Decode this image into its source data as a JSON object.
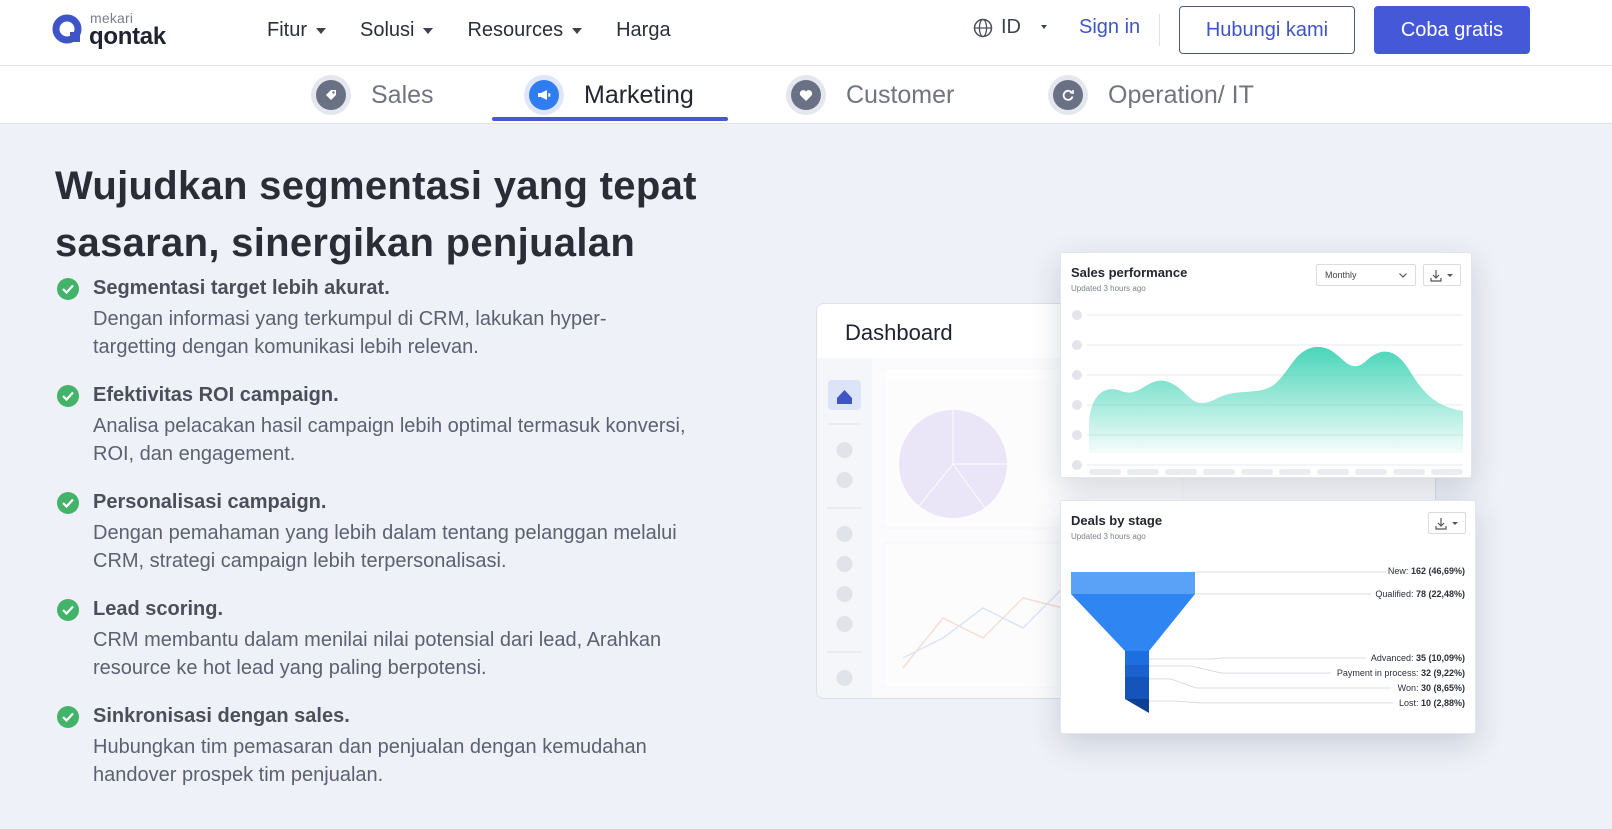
{
  "brand": {
    "small": "mekari",
    "big": "qontak",
    "color": "#3f55c7"
  },
  "nav": {
    "menu": [
      {
        "label": "Fitur",
        "dropdown": true
      },
      {
        "label": "Solusi",
        "dropdown": true
      },
      {
        "label": "Resources",
        "dropdown": true
      },
      {
        "label": "Harga",
        "dropdown": false
      }
    ],
    "language": "ID",
    "signin": "Sign in",
    "contact_button": "Hubungi kami",
    "trial_button": "Coba gratis"
  },
  "tabs": [
    {
      "label": "Sales",
      "icon": "tag-icon",
      "active": false
    },
    {
      "label": "Marketing",
      "icon": "megaphone-icon",
      "active": true
    },
    {
      "label": "Customer",
      "icon": "heart-icon",
      "active": false
    },
    {
      "label": "Operation/ IT",
      "icon": "refresh-icon",
      "active": false
    }
  ],
  "hero": {
    "headline_line1": "Wujudkan segmentasi yang tepat",
    "headline_line2": "sasaran, sinergikan penjualan",
    "features": [
      {
        "title": "Segmentasi target lebih akurat.",
        "desc_line1": "Dengan informasi yang terkumpul di CRM, lakukan hyper-",
        "desc_line2": "targetting dengan komunikasi lebih relevan."
      },
      {
        "title": "Efektivitas ROI campaign.",
        "desc_line1": "Analisa pelacakan hasil campaign lebih optimal termasuk konversi,",
        "desc_line2": "ROI, dan engagement."
      },
      {
        "title": "Personalisasi campaign.",
        "desc_line1": "Dengan pemahaman yang lebih dalam tentang pelanggan melalui",
        "desc_line2": "CRM, strategi campaign lebih terpersonalisasi."
      },
      {
        "title": "Lead scoring.",
        "desc_line1": "CRM membantu dalam menilai nilai potensial dari lead, Arahkan",
        "desc_line2": "resource ke hot lead yang paling berpotensi."
      },
      {
        "title": "Sinkronisasi dengan sales.",
        "desc_line1": "Hubungkan tim pemasaran dan penjualan dengan kemudahan",
        "desc_line2": "handover prospek tim penjualan."
      }
    ]
  },
  "dashboard": {
    "title": "Dashboard",
    "sales_card": {
      "title": "Sales performance",
      "subtitle": "Updated 3 hours ago",
      "period": "Monthly"
    },
    "deals_card": {
      "title": "Deals by stage",
      "subtitle": "Updated 3 hours ago",
      "stages": [
        {
          "label": "New:",
          "value": "162 (46,69%)"
        },
        {
          "label": "Qualified:",
          "value": "78 (22,48%)"
        },
        {
          "label": "Advanced:",
          "value": "35 (10,09%)"
        },
        {
          "label": "Payment in process:",
          "value": "32 (9,22%)"
        },
        {
          "label": "Won:",
          "value": "30 (8,65%)"
        },
        {
          "label": "Lost:",
          "value": "10 (2,88%)"
        }
      ]
    }
  },
  "colors": {
    "accent": "#4558d8",
    "check": "#44b36a",
    "teal": "#3fd3b5",
    "funnel": "#2f86f2"
  }
}
